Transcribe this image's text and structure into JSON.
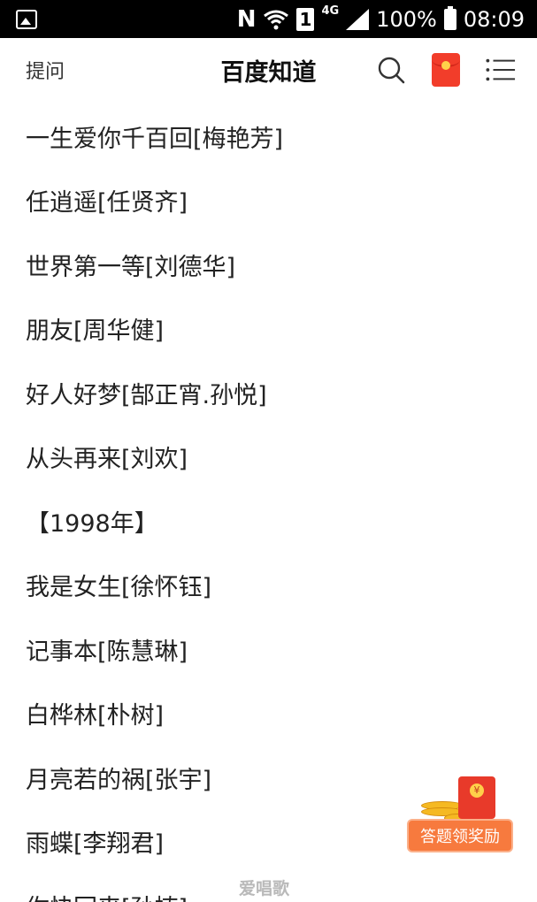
{
  "status_bar": {
    "network_label": "4G",
    "sim_slot": "1",
    "battery_percent": "100%",
    "time": "08:09",
    "n_indicator": "N"
  },
  "header": {
    "ask_label": "提问",
    "title": "百度知道"
  },
  "songs": [
    "一生爱你千百回[梅艳芳]",
    "任逍遥[任贤齐]",
    "世界第一等[刘德华]",
    "朋友[周华健]",
    "好人好梦[郜正宵.孙悦]",
    "从头再来[刘欢]",
    "【1998年】",
    "我是女生[徐怀钰]",
    "记事本[陈慧琳]",
    "白桦林[朴树]",
    "月亮若的祸[张宇]",
    "雨蝶[李翔君]",
    "你快回来[孙楠]"
  ],
  "reward": {
    "button_label": "答题领奖励"
  },
  "watermark": "爱唱歌",
  "icons": {
    "gallery": "gallery-icon",
    "wifi": "wifi-icon",
    "signal": "signal-icon",
    "battery": "battery-icon",
    "search": "search-icon",
    "red_packet": "red-packet-icon",
    "menu": "menu-icon"
  },
  "colors": {
    "status_bar": "#000000",
    "reward_orange": "#f77a3e",
    "red_packet": "#f23d2a"
  }
}
